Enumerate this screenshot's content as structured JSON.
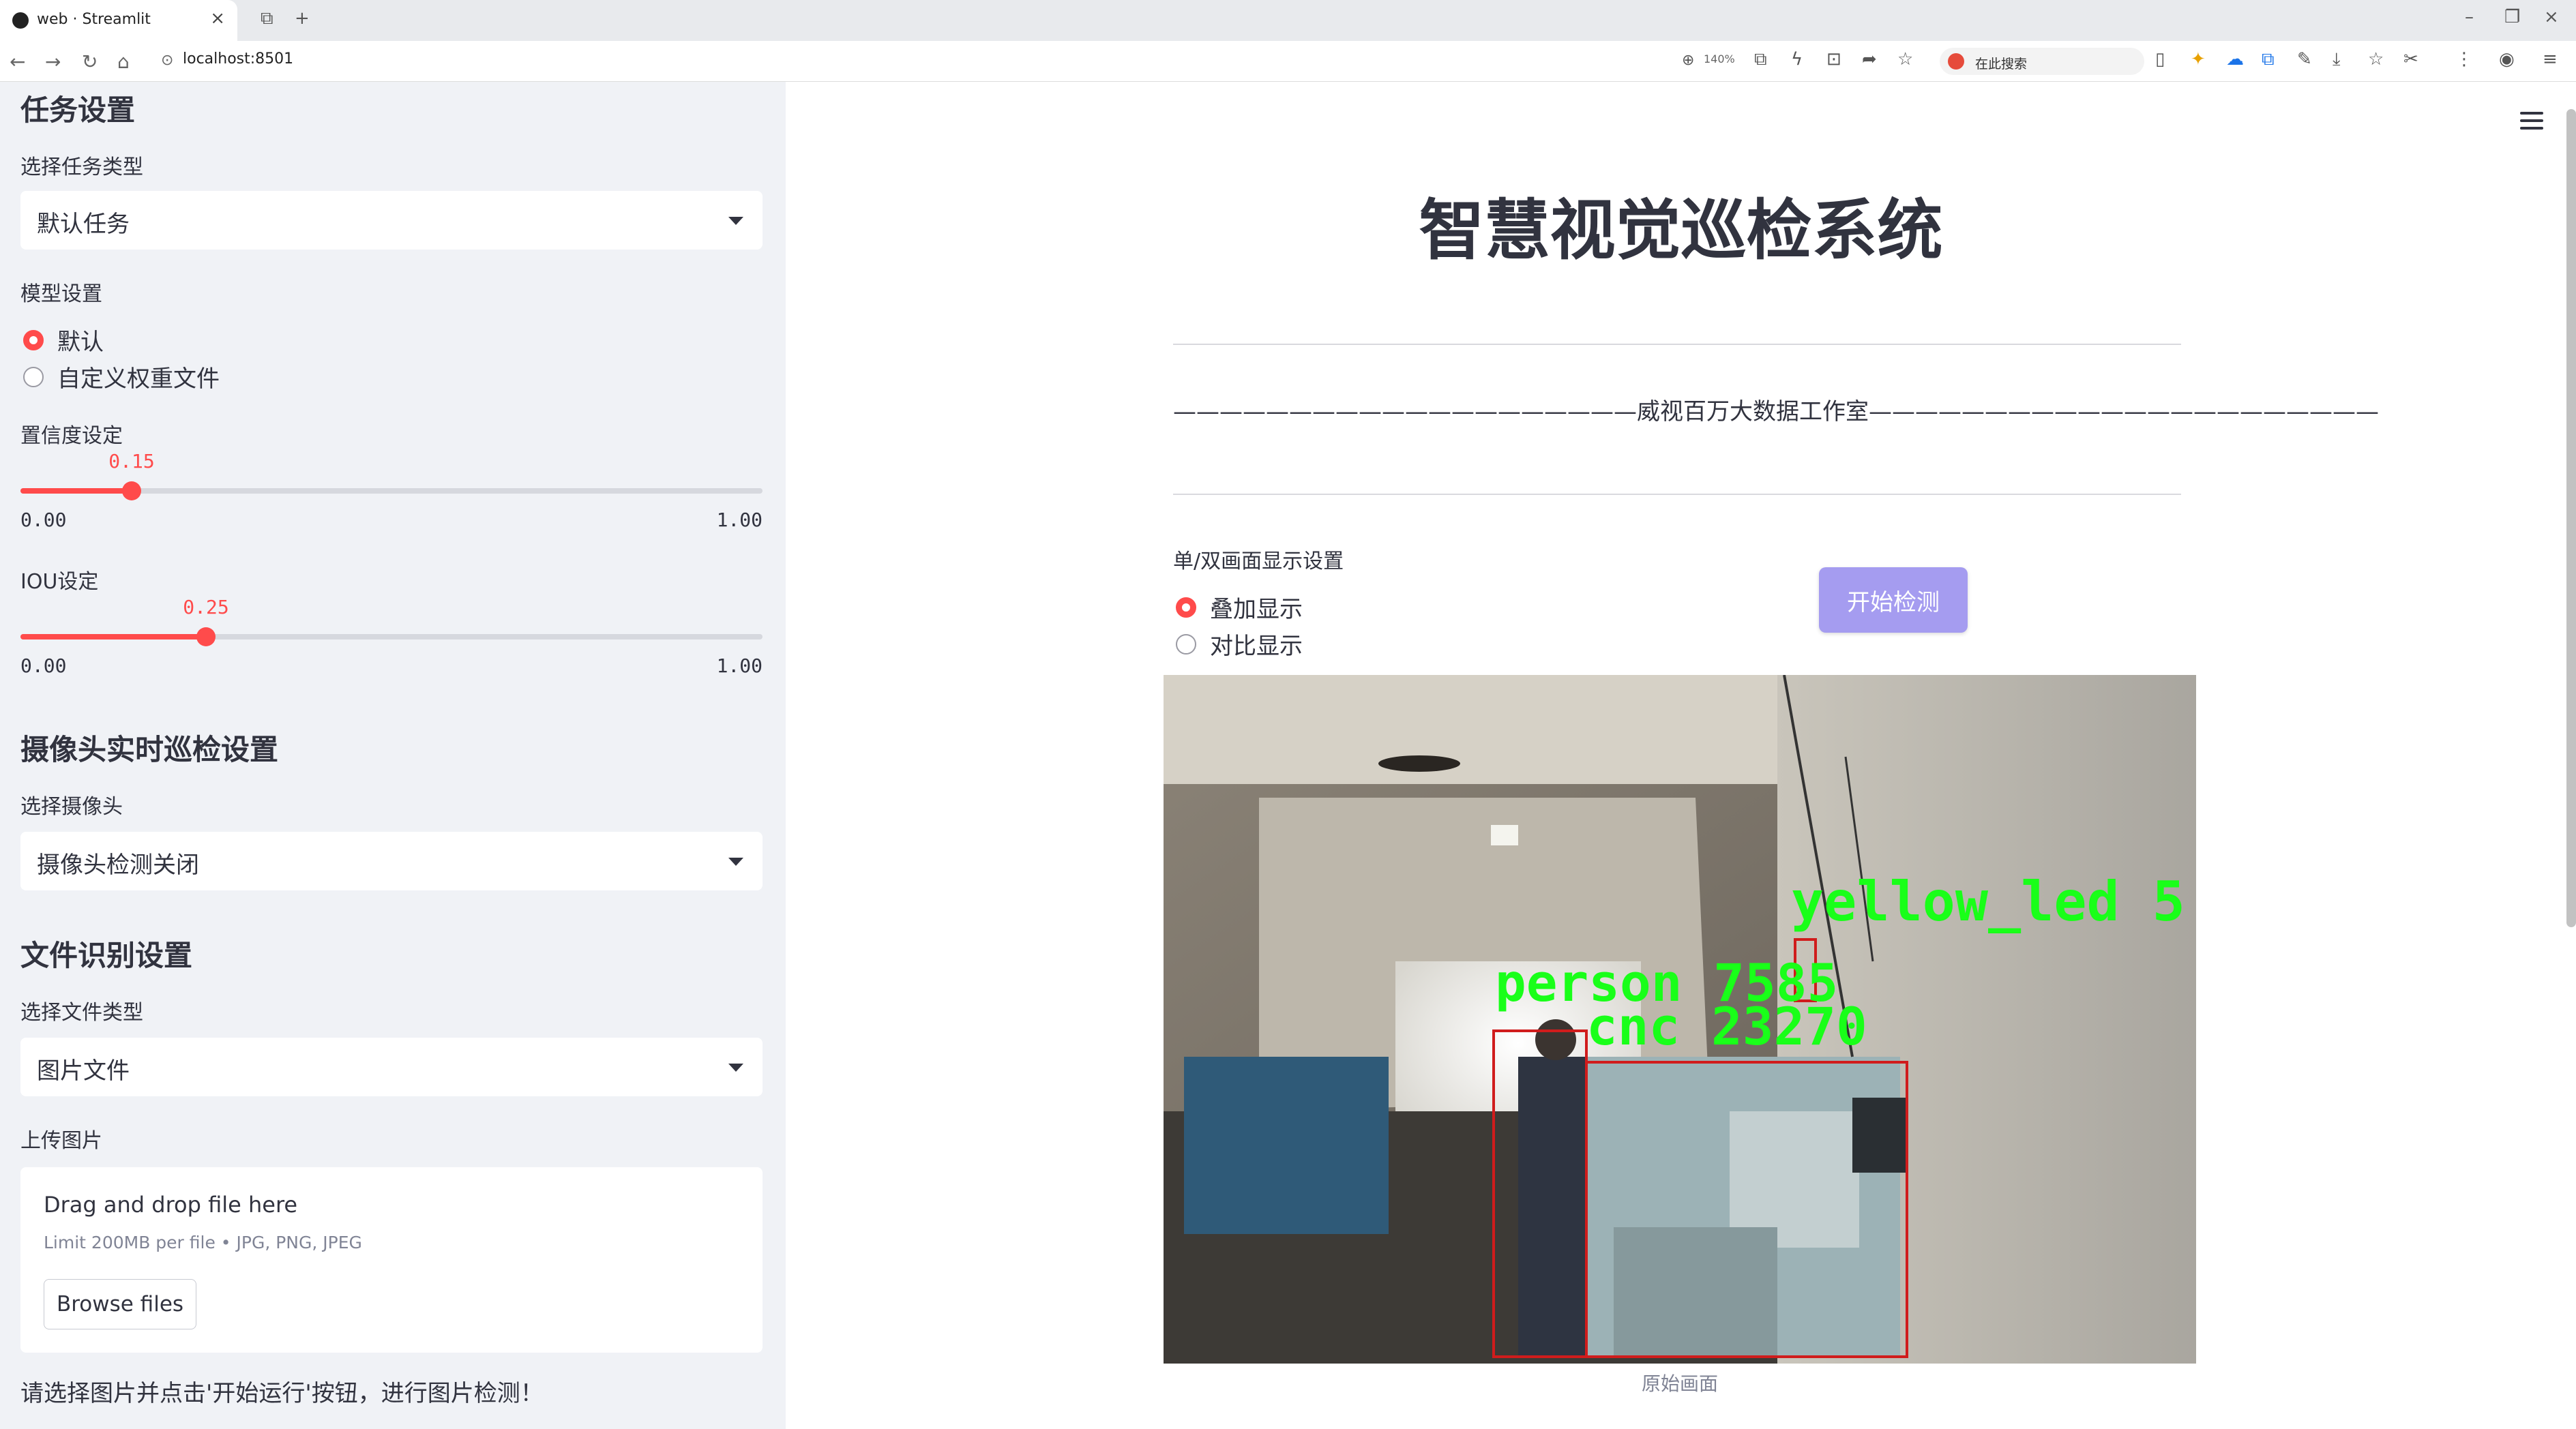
{
  "browser": {
    "tab_title": "web · Streamlit",
    "url": "localhost:8501",
    "zoom": "140%",
    "search_placeholder": "在此搜索"
  },
  "sidebar": {
    "task_heading": "任务设置",
    "task_type_label": "选择任务类型",
    "task_type_value": "默认任务",
    "model_label": "模型设置",
    "model_options": [
      "默认",
      "自定义权重文件"
    ],
    "model_selected": "默认",
    "conf_label": "置信度设定",
    "conf_value": "0.15",
    "conf_min": "0.00",
    "conf_max": "1.00",
    "conf_fraction": 0.15,
    "iou_label": "IOU设定",
    "iou_value": "0.25",
    "iou_min": "0.00",
    "iou_max": "1.00",
    "iou_fraction": 0.25,
    "camera_heading": "摄像头实时巡检设置",
    "camera_label": "选择摄像头",
    "camera_value": "摄像头检测关闭",
    "file_heading": "文件识别设置",
    "file_type_label": "选择文件类型",
    "file_type_value": "图片文件",
    "upload_label": "上传图片",
    "upload_drag_text": "Drag and drop file here",
    "upload_limit": "Limit 200MB per file • JPG, PNG, JPEG",
    "browse_button": "Browse files",
    "note": "请选择图片并点击'开始运行'按钮，进行图片检测！"
  },
  "main": {
    "title": "智慧视觉巡检系统",
    "studio_line": "————————————————————威视百万大数据工作室——————————————————————",
    "display_label": "单/双画面显示设置",
    "display_options": [
      "叠加显示",
      "对比显示"
    ],
    "display_selected": "叠加显示",
    "start_button": "开始检测",
    "image_caption": "原始画面",
    "detections": [
      {
        "label": "yellow_led",
        "score_text": "yellow_led  5"
      },
      {
        "label": "person",
        "score_text": "person  7585"
      },
      {
        "label": "cnc",
        "score_text": "cnc  23270"
      }
    ],
    "box_color": "#d01c1c",
    "label_color": "#19ff19"
  },
  "colors": {
    "accent": "#ff4b4b",
    "sidebar_bg": "#f0f2f6",
    "button_bg": "#a59cf0"
  }
}
